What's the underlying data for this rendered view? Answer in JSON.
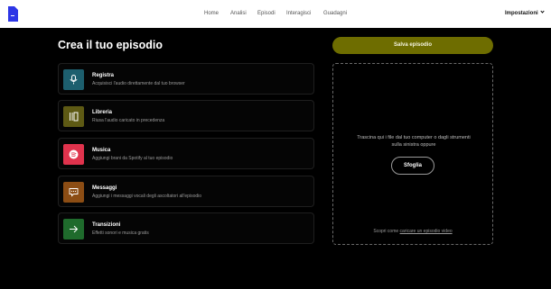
{
  "nav": {
    "items": [
      {
        "label": "Home"
      },
      {
        "label": "Analisi"
      },
      {
        "label": "Episodi"
      },
      {
        "label": "Interagisci"
      },
      {
        "label": "Guadagni"
      }
    ],
    "settings_label": "Impostazioni"
  },
  "page": {
    "title": "Crea il tuo episodio"
  },
  "options": [
    {
      "title": "Registra",
      "desc": "Acquisisci l'audio direttamente dal tuo browser",
      "icon": "microphone-icon",
      "color": "#1d5f6e"
    },
    {
      "title": "Libreria",
      "desc": "Riusa l'audio caricato in precedenza",
      "icon": "library-icon",
      "color": "#5e5a14"
    },
    {
      "title": "Musica",
      "desc": "Aggiungi brani da Spotify al tuo episodio",
      "icon": "spotify-icon",
      "color": "#e0334d"
    },
    {
      "title": "Messaggi",
      "desc": "Aggiungi i messaggi vocali degli ascoltatori all'episodio",
      "icon": "message-icon",
      "color": "#8c4d14"
    },
    {
      "title": "Transizioni",
      "desc": "Effetti sonori e musica gratis",
      "icon": "arrow-right-icon",
      "color": "#1f6b2c"
    }
  ],
  "actions": {
    "save_label": "Salva episodio",
    "save_color": "#6e6d00"
  },
  "dropzone": {
    "text": "Trascina qui i file dal tuo computer o dagli strumenti sulla sinistra oppure",
    "browse_label": "Sfoglia",
    "footer_prefix": "Scopri come ",
    "footer_link": "caricare un episodio video"
  }
}
